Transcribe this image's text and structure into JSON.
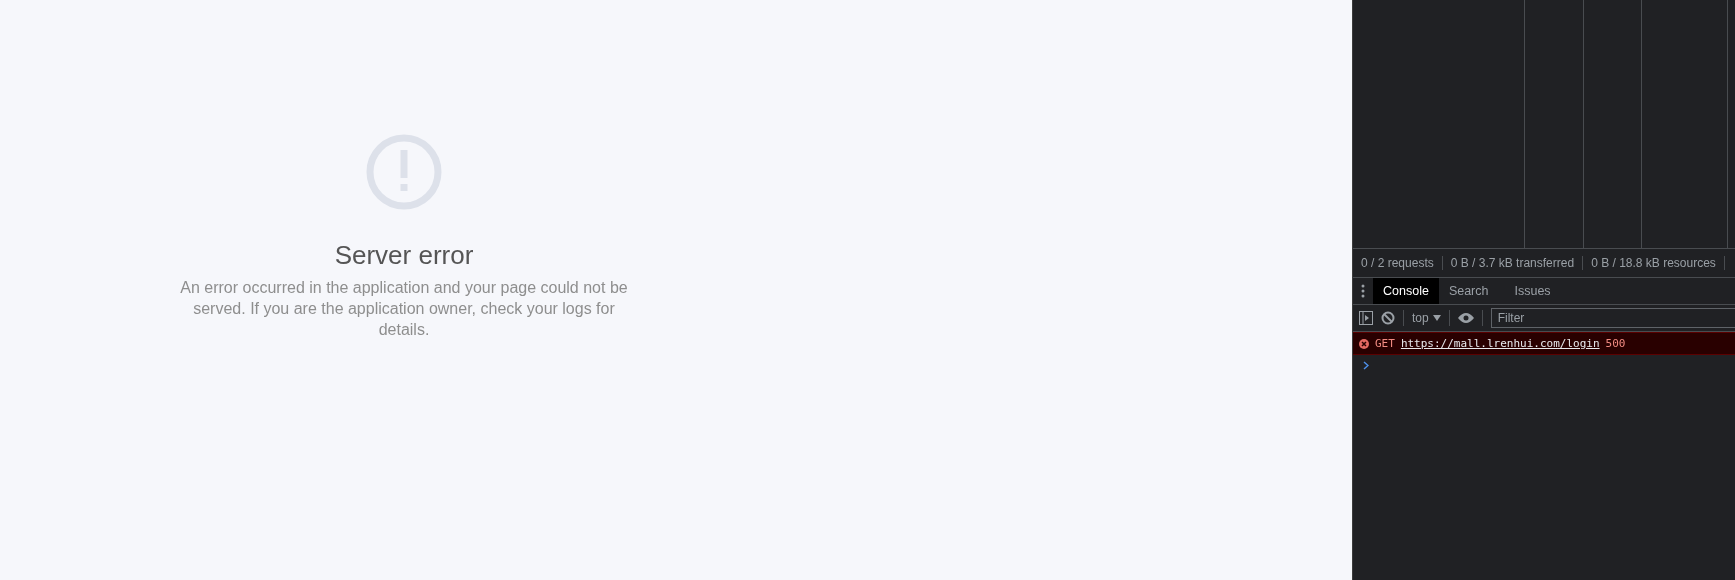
{
  "page": {
    "title": "Server error",
    "message": "An error occurred in the application and your page could not be served. If you are the application owner, check your logs for details."
  },
  "devtools": {
    "network_summary": [
      "0 / 2 requests",
      "0 B / 3.7 kB transferred",
      "0 B / 18.8 kB resources"
    ],
    "tabs": [
      {
        "label": "Console",
        "selected": true
      },
      {
        "label": "Search",
        "selected": false
      },
      {
        "label": "Issues",
        "selected": false
      }
    ],
    "toolbar": {
      "context": "top",
      "filter": {
        "placeholder": "Filter"
      }
    },
    "messages": [
      {
        "kind": "error",
        "method": "GET",
        "url": "https://mall.lrenhui.com/login",
        "status": "500"
      }
    ]
  }
}
